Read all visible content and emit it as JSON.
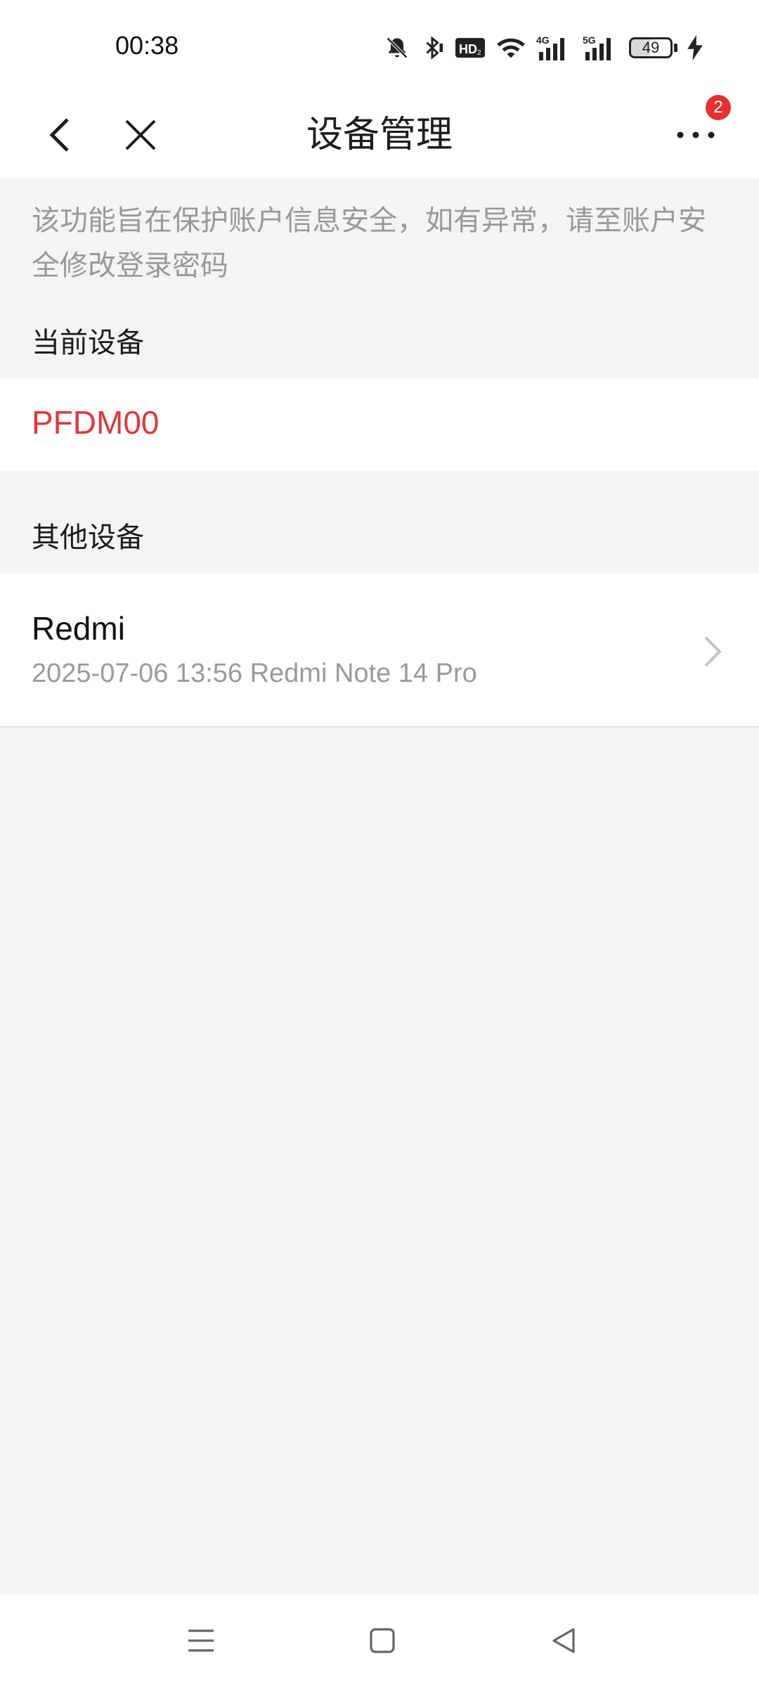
{
  "status_bar": {
    "time": "00:38",
    "battery_level": 49,
    "battery_text": "49",
    "icons": [
      "bell-muted-icon",
      "bluetooth-icon",
      "hd-icon",
      "wifi-icon",
      "signal-4g-icon",
      "signal-5g-icon",
      "battery-icon",
      "charging-icon"
    ]
  },
  "app_bar": {
    "title": "设备管理",
    "notification_count": "2",
    "icons": [
      "back-icon",
      "close-icon",
      "more-icon"
    ]
  },
  "notice": "该功能旨在保护账户信息安全，如有异常，请至账户安全修改登录密码",
  "current_section": {
    "label": "当前设备",
    "device": "PFDM00"
  },
  "other_section": {
    "label": "其他设备",
    "devices": [
      {
        "name": "Redmi",
        "detail": "2025-07-06 13:56 Redmi Note 14 Pro"
      }
    ]
  },
  "nav_bar": {
    "icons": [
      "menu-icon",
      "home-icon",
      "back-triangle-icon"
    ]
  },
  "colors": {
    "accent_red": "#e0373a",
    "badge_red": "#e8302f",
    "page_background": "#f3f4f6"
  }
}
